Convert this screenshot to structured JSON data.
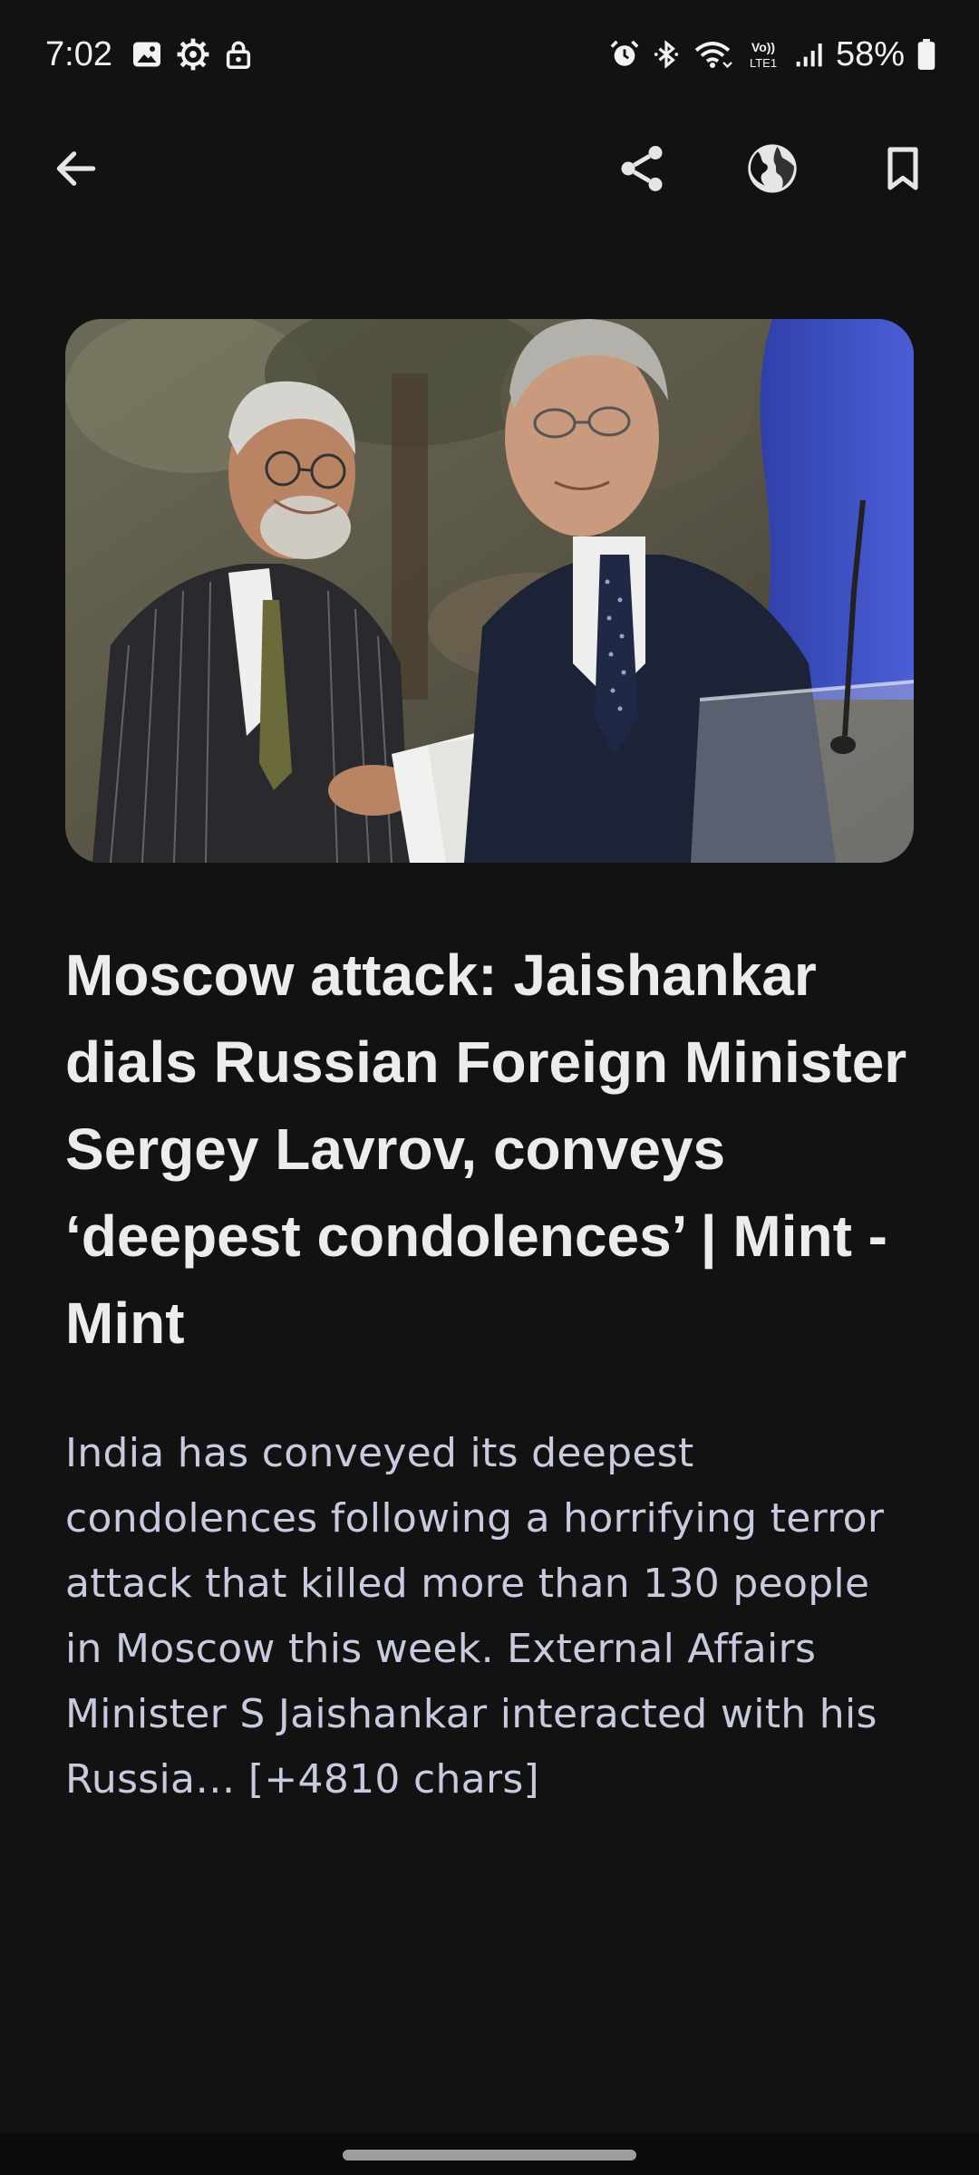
{
  "status_bar": {
    "time": "7:02",
    "battery": "58%",
    "left_icons": [
      "image-icon",
      "settings-icon",
      "lock-icon"
    ],
    "right_icons": [
      "alarm-icon",
      "bluetooth-icon",
      "wifi-icon",
      "volte-icon",
      "signal-icon",
      "battery-icon"
    ],
    "volte_text": "Vo)) LTE1"
  },
  "app_bar": {
    "icons": [
      "back-arrow-icon",
      "share-icon",
      "globe-icon",
      "bookmark-icon"
    ]
  },
  "article": {
    "image_description_icon": "article-image",
    "title": "Moscow attack: Jaishankar dials Russian Foreign Minister Sergey Lavrov, conveys ‘deepest condolences’ | Mint - Mint",
    "summary": "India has conveyed its deepest condolences following a horrifying terror attack that killed more than 130 people in Moscow this week. External Affairs Minister S Jaishankar interacted with his Russia… [+4810 chars]"
  },
  "colors": {
    "background": "#121212",
    "title": "#ececec",
    "summary": "#c8cbe0",
    "icons": "#e6e6e6"
  }
}
